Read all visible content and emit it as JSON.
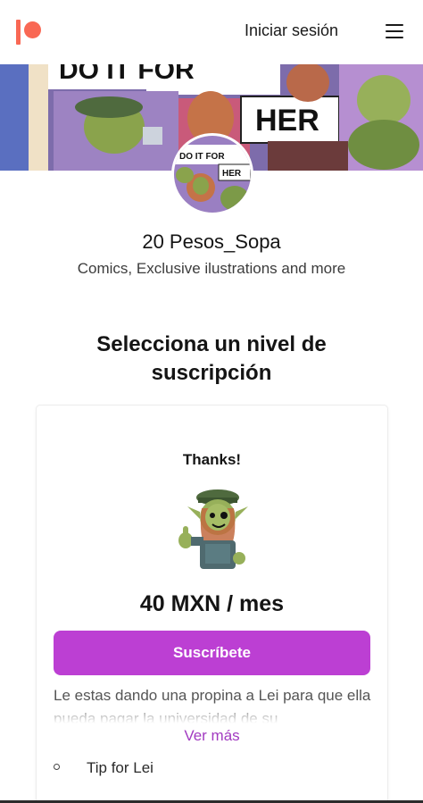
{
  "header": {
    "login_label": "Iniciar sesión"
  },
  "banner": {
    "top_text": "DO IT FOR",
    "her_text": "HER"
  },
  "avatar": {
    "mini_text_top": "DO IT FOR",
    "mini_text_her": "HER"
  },
  "creator": {
    "name": "20 Pesos_Sopa",
    "description": "Comics, Exclusive ilustrations and more"
  },
  "section": {
    "title": "Selecciona un nivel de suscripción"
  },
  "tier": {
    "name": "Thanks!",
    "price": "40 MXN / mes",
    "subscribe_label": "Suscríbete",
    "description": "Le estas dando una propina a Lei para que ella pueda pagar la universidad de su",
    "more_label": "Ver más",
    "benefits": [
      "Tip for Lei"
    ]
  },
  "colors": {
    "brand": "#f96854",
    "subscribe_button": "#bc3fd3",
    "link": "#a23bc1"
  }
}
